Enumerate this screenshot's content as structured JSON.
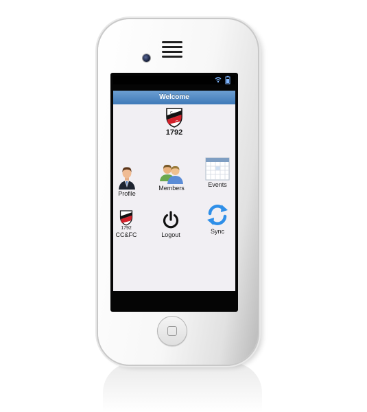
{
  "app": {
    "title": "Welcome",
    "club_year": "1792"
  },
  "status_bar": {
    "icons": [
      "wifi-icon",
      "battery-icon"
    ]
  },
  "menu": {
    "profile": {
      "label": "Profile",
      "icon": "businessman-icon"
    },
    "members": {
      "label": "Members",
      "icon": "people-icon"
    },
    "events": {
      "label": "Events",
      "icon": "calendar-icon"
    },
    "club": {
      "label": "CC&FC",
      "icon": "club-crest-icon",
      "year": "1792"
    },
    "logout": {
      "label": "Logout",
      "icon": "power-icon"
    },
    "sync": {
      "label": "Sync",
      "icon": "sync-arrows-icon"
    }
  },
  "colors": {
    "title_bar": "#4a85c2",
    "screen_bg": "#f1eff3",
    "crest_red": "#d3212b",
    "sync_blue": "#2f8fe8"
  }
}
